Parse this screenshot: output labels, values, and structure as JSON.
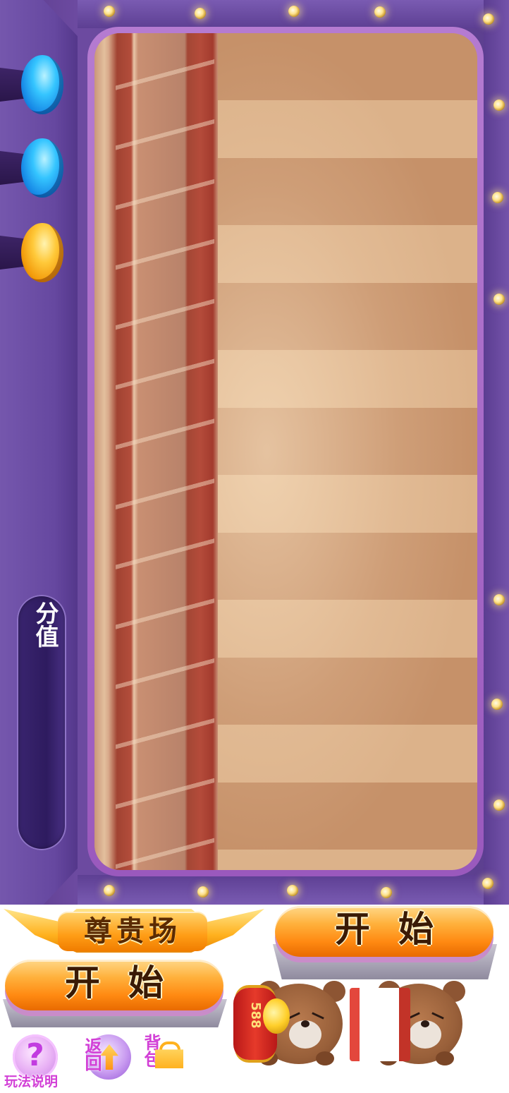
{
  "machine": {
    "bet_label": "分值",
    "levers": [
      {
        "name": "blue-lever-1",
        "color": "#1e97ef"
      },
      {
        "name": "blue-lever-2",
        "color": "#1e97ef"
      },
      {
        "name": "gold-lever",
        "color": "#ffb21e"
      }
    ]
  },
  "sprites": {
    "vip_label": "尊贵场",
    "start_label_1": "开始",
    "start_label_2": "开始",
    "lantern_text": "588",
    "help_label": "玩法说明",
    "back_label": "返回",
    "bag_label": "背包"
  },
  "icons": {
    "help": "question-mark-icon",
    "back": "up-arrow-icon",
    "bag": "gift-bag-icon"
  },
  "colors": {
    "frame_purple": "#6c4aa0",
    "button_orange": "#ff9d16",
    "label_magenta": "#d23fd6"
  }
}
